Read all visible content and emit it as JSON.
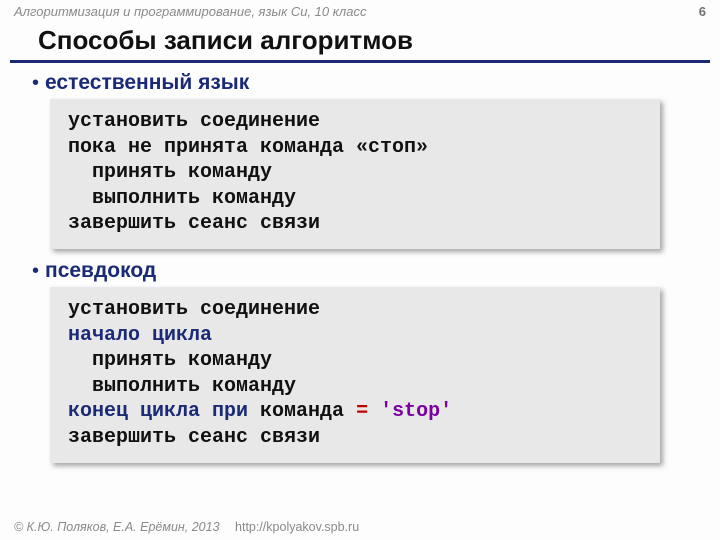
{
  "header": {
    "course": "Алгоритмизация и программирование, язык Си, 10 класс",
    "page_number": "6"
  },
  "title": "Способы записи алгоритмов",
  "sections": [
    {
      "heading": "естественный язык"
    },
    {
      "heading": "псевдокод"
    }
  ],
  "natural_code": {
    "l1": "установить соединение",
    "l2": "пока не принята команда «стоп»",
    "l3": "  принять команду",
    "l4": "  выполнить команду",
    "l5": "завершить сеанс связи"
  },
  "pseudo_code": {
    "l1": "установить соединение",
    "l2": "начало цикла",
    "l3": "  принять команду",
    "l4": "  выполнить команду",
    "l5_kw1": "конец цикла при",
    "l5_txt": " команда ",
    "l5_sym": "=",
    "l5_sp": " ",
    "l5_str": "'stop'",
    "l6": "завершить сеанс связи"
  },
  "footer": {
    "copyright": "© К.Ю. Поляков, Е.А. Ерёмин, 2013",
    "url": "http://kpolyakov.spb.ru"
  }
}
